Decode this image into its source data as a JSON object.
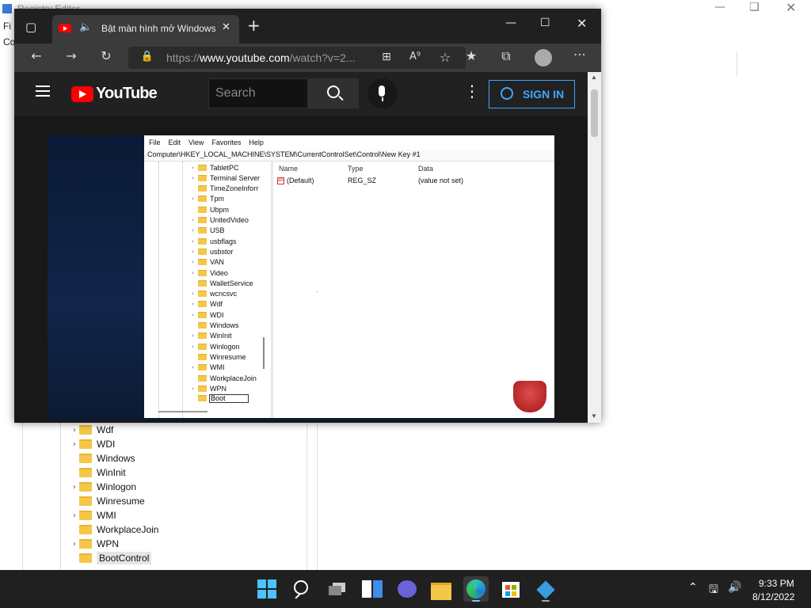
{
  "background_app": {
    "title": "Registry Editor",
    "menu_first": "Fi",
    "address_first": "Co",
    "tree_items": [
      {
        "label": "Wdf",
        "expandable": true
      },
      {
        "label": "WDI",
        "expandable": true
      },
      {
        "label": "Windows",
        "expandable": false
      },
      {
        "label": "WinInit",
        "expandable": false
      },
      {
        "label": "Winlogon",
        "expandable": true
      },
      {
        "label": "Winresume",
        "expandable": false
      },
      {
        "label": "WMI",
        "expandable": true
      },
      {
        "label": "WorkplaceJoin",
        "expandable": false
      },
      {
        "label": "WPN",
        "expandable": true
      },
      {
        "label": "BootControl",
        "expandable": false,
        "selected": true
      }
    ]
  },
  "browser": {
    "tab_title": "Bật màn hình mở Windows",
    "url_prefix": "https://",
    "url_host": "www.youtube.com",
    "url_path": "/watch?v=2..."
  },
  "youtube": {
    "logo_text": "YouTube",
    "search_placeholder": "Search",
    "signin_label": "SIGN IN"
  },
  "video_registry": {
    "menu": [
      "File",
      "Edit",
      "View",
      "Favorites",
      "Help"
    ],
    "address": "Computer\\HKEY_LOCAL_MACHINE\\SYSTEM\\CurrentControlSet\\Control\\New Key #1",
    "tree_items": [
      {
        "label": "TabletPC",
        "expandable": true
      },
      {
        "label": "Terminal Server",
        "expandable": true
      },
      {
        "label": "TimeZoneInforr",
        "expandable": false
      },
      {
        "label": "Tpm",
        "expandable": true
      },
      {
        "label": "Ubpm",
        "expandable": false
      },
      {
        "label": "UnitedVideo",
        "expandable": true
      },
      {
        "label": "USB",
        "expandable": true
      },
      {
        "label": "usbflags",
        "expandable": true
      },
      {
        "label": "usbstor",
        "expandable": true
      },
      {
        "label": "VAN",
        "expandable": true
      },
      {
        "label": "Video",
        "expandable": true
      },
      {
        "label": "WalletService",
        "expandable": false
      },
      {
        "label": "wcncsvc",
        "expandable": true
      },
      {
        "label": "Wdf",
        "expandable": true
      },
      {
        "label": "WDI",
        "expandable": true
      },
      {
        "label": "Windows",
        "expandable": false
      },
      {
        "label": "WinInit",
        "expandable": true
      },
      {
        "label": "Winlogon",
        "expandable": true
      },
      {
        "label": "Winresume",
        "expandable": false
      },
      {
        "label": "WMI",
        "expandable": true
      },
      {
        "label": "WorkplaceJoin",
        "expandable": false
      },
      {
        "label": "WPN",
        "expandable": true
      }
    ],
    "edit_value": "Boot",
    "columns": {
      "name": "Name",
      "type": "Type",
      "data": "Data"
    },
    "row": {
      "name": "(Default)",
      "type": "REG_SZ",
      "data": "(value not set)"
    }
  },
  "taskbar": {
    "apps": [
      "start-icon",
      "search-icon",
      "task-view-icon",
      "widgets-icon",
      "chat-icon",
      "file-explorer-icon",
      "edge-icon",
      "store-icon",
      "registry-editor-icon"
    ],
    "time": "9:33 PM",
    "date": "8/12/2022"
  }
}
